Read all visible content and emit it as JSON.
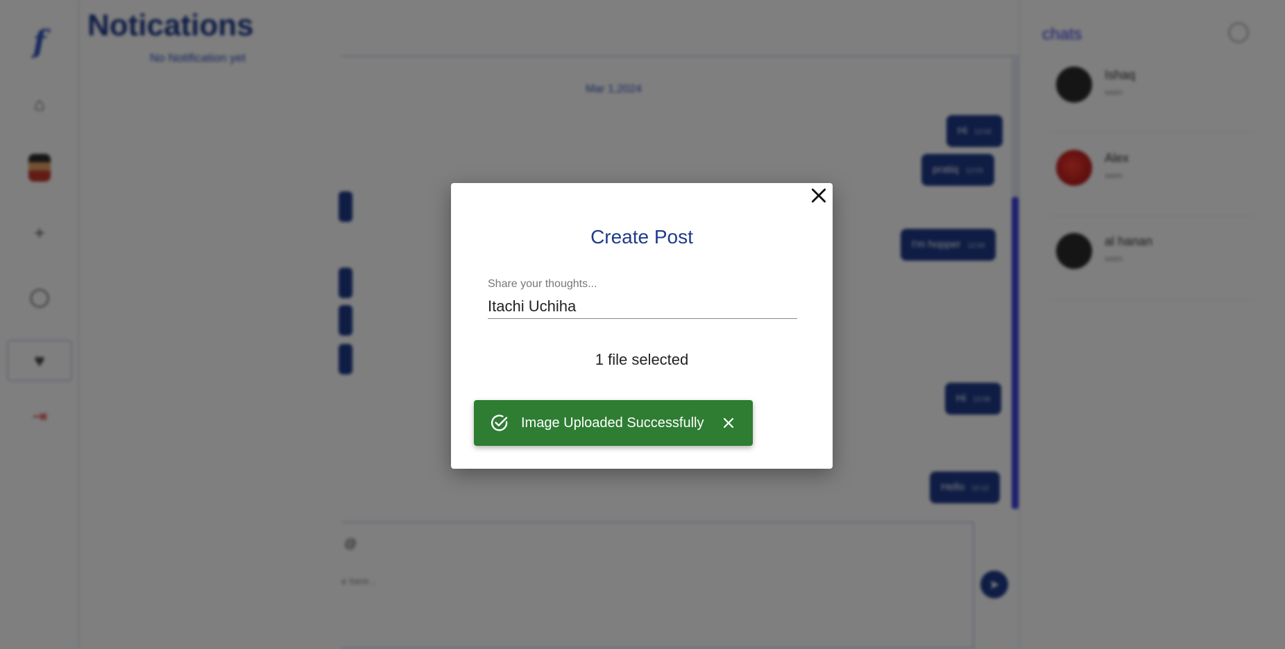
{
  "background": {
    "notifications": {
      "title": "Notications",
      "empty_text": "No Notification yet"
    },
    "chat": {
      "date": "Mar 1,2024",
      "messages": [
        {
          "text": "Hi",
          "time": "12:02"
        },
        {
          "text": "pratiq",
          "time": "12:03"
        },
        {
          "text": "I'm hopper",
          "time": "12:04"
        },
        {
          "text": "Hi",
          "time": "12:09"
        },
        {
          "text": "Hello",
          "time": "12:12"
        }
      ],
      "composer_at": "@",
      "composer_placeholder": "e here..."
    },
    "chats": {
      "title": "chats",
      "contacts": [
        {
          "name": "Ishaq",
          "sub": "seen"
        },
        {
          "name": "Alex",
          "sub": "seen"
        },
        {
          "name": "al hanan",
          "sub": "seen"
        }
      ]
    }
  },
  "modal": {
    "title": "Create Post",
    "input_label": "Share your thoughts...",
    "input_value": "Itachi Uchiha",
    "file_status": "1 file selected"
  },
  "toast": {
    "message": "Image Uploaded Successfully"
  }
}
